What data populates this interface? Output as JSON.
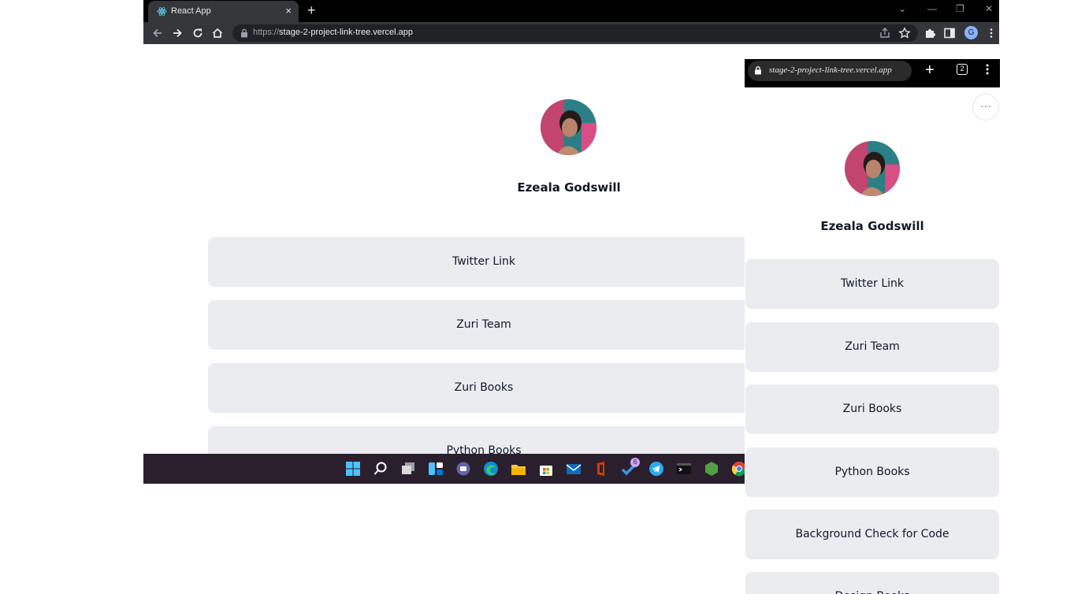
{
  "desktop": {
    "tab": {
      "title": "React App",
      "close_glyph": "×"
    },
    "new_tab_glyph": "+",
    "url": {
      "scheme": "https://",
      "host": "stage-2-project-link-tree.vercel.app"
    },
    "account_initial": "G",
    "window_controls": {
      "minimize": "—",
      "restore": "❐",
      "close": "✕",
      "dropdown": "⌄"
    },
    "profile": {
      "name": "Ezeala Godswill"
    },
    "links": [
      "Twitter Link",
      "Zuri Team",
      "Zuri Books",
      "Python Books"
    ],
    "taskbar": {
      "badge_count": "6",
      "icons": [
        "windows-start-icon",
        "search-icon",
        "task-view-icon",
        "widgets-icon",
        "teams-chat-icon",
        "edge-icon",
        "file-explorer-icon",
        "store-icon",
        "mail-icon",
        "office-icon",
        "todo-icon",
        "telegram-icon",
        "terminal-icon",
        "nodejs-icon",
        "chrome-icon"
      ]
    }
  },
  "mobile": {
    "url": "stage-2-project-link-tree.vercel.app",
    "plus_glyph": "+",
    "tab_count": "2",
    "more_glyph": "···",
    "profile": {
      "name": "Ezeala Godswill"
    },
    "links": [
      "Twitter Link",
      "Zuri Team",
      "Zuri Books",
      "Python Books",
      "Background Check for Code",
      "Design Books"
    ]
  },
  "colors": {
    "button_bg": "#eaecf0",
    "text": "#101828",
    "chrome_dark": "#35363a",
    "taskbar": "#2a1f2c"
  }
}
